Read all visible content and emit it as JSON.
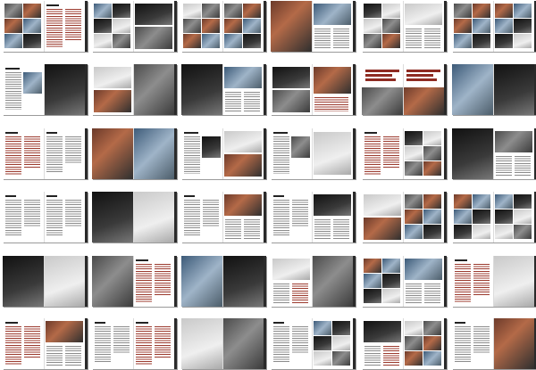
{
  "title": "",
  "layout": {
    "rows": 6,
    "columns": 6
  },
  "colors": {
    "background": "#ffffff",
    "body_text": "#8c8c8c",
    "accent_text": "#9c3b2f",
    "banner": "#8e2b22"
  },
  "spreads": [
    {
      "row": 1,
      "col": 1,
      "left": "photo-grid",
      "right": "text-red"
    },
    {
      "row": 1,
      "col": 2,
      "left": "photo-grid",
      "right": "photo-stack"
    },
    {
      "row": 1,
      "col": 3,
      "left": "photo-grid",
      "right": "photo-grid"
    },
    {
      "row": 1,
      "col": 4,
      "left": "photo-full",
      "right": "photo-text"
    },
    {
      "row": 1,
      "col": 5,
      "left": "photo-grid",
      "right": "photo-text"
    },
    {
      "row": 1,
      "col": 6,
      "left": "photo-grid",
      "right": "photo-grid"
    },
    {
      "row": 2,
      "col": 1,
      "left": "text-photo",
      "right": "photo-full"
    },
    {
      "row": 2,
      "col": 2,
      "left": "photo-stack",
      "right": "photo-full"
    },
    {
      "row": 2,
      "col": 3,
      "left": "photo-dark",
      "right": "photo-text"
    },
    {
      "row": 2,
      "col": 4,
      "left": "photo-stack",
      "right": "photo-red"
    },
    {
      "row": 2,
      "col": 5,
      "left": "photo-banner",
      "right": "photo-banner"
    },
    {
      "row": 2,
      "col": 6,
      "left": "photo-full",
      "right": "photo-full"
    },
    {
      "row": 3,
      "col": 1,
      "left": "text-red",
      "right": "text"
    },
    {
      "row": 3,
      "col": 2,
      "left": "photo-full",
      "right": "photo-full"
    },
    {
      "row": 3,
      "col": 3,
      "left": "text-photo",
      "right": "photo-stack"
    },
    {
      "row": 3,
      "col": 4,
      "left": "text-photo",
      "right": "photo-light"
    },
    {
      "row": 3,
      "col": 5,
      "left": "text-red",
      "right": "photo-grid"
    },
    {
      "row": 3,
      "col": 6,
      "left": "photo-dark",
      "right": "photo-text"
    },
    {
      "row": 4,
      "col": 1,
      "left": "text",
      "right": "text"
    },
    {
      "row": 4,
      "col": 2,
      "left": "photo-full",
      "right": "photo-full"
    },
    {
      "row": 4,
      "col": 3,
      "left": "text",
      "right": "photo-text"
    },
    {
      "row": 4,
      "col": 4,
      "left": "text",
      "right": "photo-text"
    },
    {
      "row": 4,
      "col": 5,
      "left": "photo-stack",
      "right": "photo-grid"
    },
    {
      "row": 4,
      "col": 6,
      "left": "photo-grid",
      "right": "photo-grid"
    },
    {
      "row": 5,
      "col": 1,
      "left": "photo-full",
      "right": "photo-full"
    },
    {
      "row": 5,
      "col": 2,
      "left": "photo-full",
      "right": "text-red"
    },
    {
      "row": 5,
      "col": 3,
      "left": "photo-full",
      "right": "photo-full"
    },
    {
      "row": 5,
      "col": 4,
      "left": "photo-text",
      "right": "photo-full"
    },
    {
      "row": 5,
      "col": 5,
      "left": "photo-grid",
      "right": "photo-text"
    },
    {
      "row": 5,
      "col": 6,
      "left": "text-red",
      "right": "photo-full"
    },
    {
      "row": 6,
      "col": 1,
      "left": "text-red",
      "right": "photo-text"
    },
    {
      "row": 6,
      "col": 2,
      "left": "text",
      "right": "text-red"
    },
    {
      "row": 6,
      "col": 3,
      "left": "photo-full",
      "right": "photo-full"
    },
    {
      "row": 6,
      "col": 4,
      "left": "text",
      "right": "photo-grid"
    },
    {
      "row": 6,
      "col": 5,
      "left": "photo-text",
      "right": "photo-grid"
    },
    {
      "row": 6,
      "col": 6,
      "left": "text",
      "right": "photo-full"
    }
  ]
}
